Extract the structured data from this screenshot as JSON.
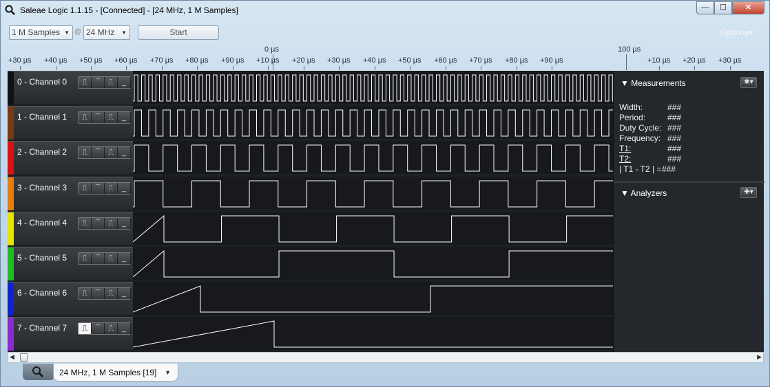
{
  "window": {
    "title": "Saleae Logic 1.1.15 - [Connected] - [24 MHz, 1 M Samples]",
    "close_label": "✕",
    "minimize_label": "—",
    "maximize_label": "☐"
  },
  "toolbar": {
    "sample_count": "1 M Samples",
    "sample_rate": "24 MHz",
    "at_symbol": "@",
    "start_label": "Start",
    "options_label": "Options▾"
  },
  "ruler": {
    "major_labels": [
      "0 µs",
      "100 µs"
    ],
    "minor_labels": [
      "+30 µs",
      "+40 µs",
      "+50 µs",
      "+60 µs",
      "+70 µs",
      "+80 µs",
      "+90 µs",
      "+10 µs",
      "+20 µs",
      "+30 µs",
      "+40 µs",
      "+50 µs",
      "+60 µs",
      "+70 µs",
      "+80 µs",
      "+90 µs",
      "+10 µs",
      "+20 µs",
      "+30 µs"
    ]
  },
  "channels": [
    {
      "label": "0 - Channel 0",
      "color": "#111111",
      "period_us": 2.0
    },
    {
      "label": "1 - Channel 1",
      "color": "#7a3a10",
      "period_us": 4.0
    },
    {
      "label": "2 - Channel 2",
      "color": "#dd1010",
      "period_us": 8.0
    },
    {
      "label": "3 - Channel 3",
      "color": "#e77b10",
      "period_us": 16.0
    },
    {
      "label": "4 - Channel 4",
      "color": "#e6e600",
      "period_us": 32.0
    },
    {
      "label": "5 - Channel 5",
      "color": "#22bb22",
      "period_us": 64.0
    },
    {
      "label": "6 - Channel 6",
      "color": "#1122cc",
      "period_us": 128.0
    },
    {
      "label": "7 - Channel 7",
      "color": "#8a2ad0",
      "period_us": 256.0
    }
  ],
  "trigger_icons": [
    "rising-edge",
    "high",
    "falling-edge",
    "low"
  ],
  "trigger_glyphs": [
    "⎍",
    "¯",
    "⎍",
    "_"
  ],
  "measurements": {
    "title": "Measurements",
    "rows": [
      {
        "label": "Width:",
        "value": "###"
      },
      {
        "label": "Period:",
        "value": "###"
      },
      {
        "label": "Duty Cycle:",
        "value": "###"
      },
      {
        "label": "Frequency:",
        "value": "###"
      },
      {
        "label": "T1:",
        "value": "###"
      },
      {
        "label": "T2:",
        "value": "###"
      },
      {
        "label": "| T1 - T2 | =",
        "value": "###"
      }
    ]
  },
  "analyzers": {
    "title": "Analyzers"
  },
  "bottom_tab": {
    "session_label": "24 MHz, 1 M Samples [19]"
  }
}
